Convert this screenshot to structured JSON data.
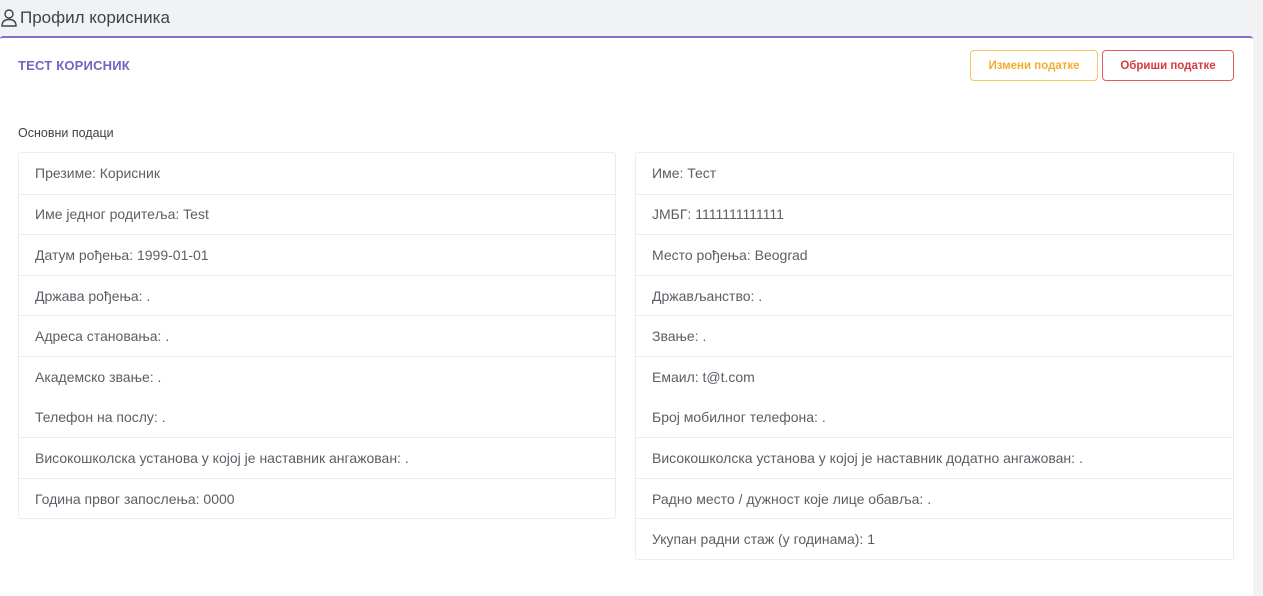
{
  "header": {
    "title": "Профил корисника",
    "icon": "user-icon"
  },
  "card": {
    "title": "ТЕСТ КОРИСНИК",
    "edit_label": "Измени податке",
    "delete_label": "Обриши податке",
    "colors": {
      "accent": "#6f68c0",
      "edit": "#f3ad2e",
      "delete": "#d63c3c"
    }
  },
  "section": {
    "label": "Основни подаци"
  },
  "left_fields": [
    "Презиме: Корисник",
    "Име једног родитеља: Test",
    "Датум рођења: 1999-01-01",
    "Држава рођења: .",
    "Адреса становања: .",
    "Академско звање: .",
    "Телефон на послу: .",
    "Високошколска установа у којој је наставник ангажован: .",
    "Година првог запослења: 0000"
  ],
  "right_fields": [
    "Име: Тест",
    "ЈМБГ: 1111111111111",
    "Место рођења: Beograd",
    "Држављанство: .",
    "Звање: .",
    "Емаил: t@t.com",
    "Број мобилног телефона: .",
    "Високошколска установа у којој је наставник додатно ангажован: .",
    "Радно место / дужност које лице обавља: .",
    "Укупан радни стаж (у годинама): 1"
  ]
}
